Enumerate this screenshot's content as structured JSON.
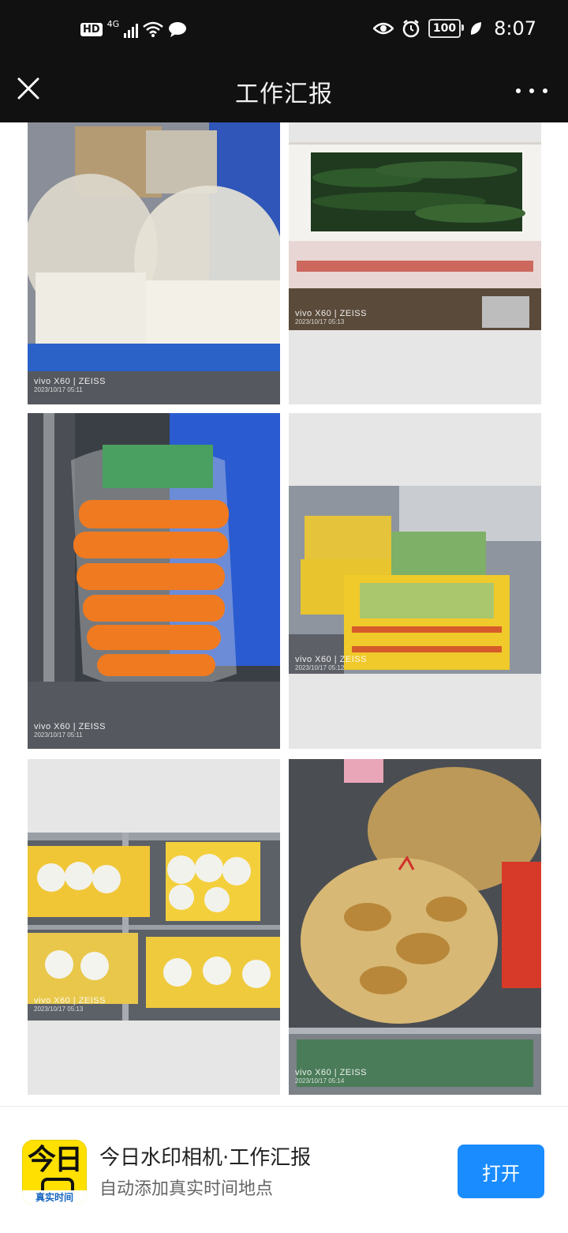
{
  "status_bar": {
    "hd": "HD",
    "network": "4G",
    "battery": "100",
    "time": "8:07",
    "icons": [
      "signal-icon",
      "wifi-icon",
      "message-icon",
      "eye-icon",
      "alarm-icon",
      "battery-icon",
      "leaf-icon"
    ]
  },
  "header": {
    "title": "工作汇报",
    "close_icon": "close-icon",
    "more_icon": "more-icon"
  },
  "photos": [
    {
      "subject": "tofu in plastic bags, blue crate",
      "watermark_brand": "vivo X60 | ZEISS",
      "watermark_date": "2023/10/17 05:11"
    },
    {
      "subject": "cucumbers in foam box",
      "watermark_brand": "vivo X60 | ZEISS",
      "watermark_date": "2023/10/17 05:13"
    },
    {
      "subject": "bag of carrots",
      "watermark_brand": "vivo X60 | ZEISS",
      "watermark_date": "2023/10/17 05:11"
    },
    {
      "subject": "packed green vegetables",
      "watermark_brand": "vivo X60 | ZEISS",
      "watermark_date": "2023/10/17 05:12"
    },
    {
      "subject": "packed cabbages on shelves",
      "watermark_brand": "vivo X60 | ZEISS",
      "watermark_date": "2023/10/17 05:13"
    },
    {
      "subject": "bag of ginger",
      "watermark_brand": "vivo X60 | ZEISS",
      "watermark_date": "2023/10/17 05:14"
    }
  ],
  "promo": {
    "icon_text": "今日",
    "icon_strip": "真实时间",
    "title": "今日水印相机·工作汇报",
    "subtitle": "自动添加真实时间地点",
    "open_label": "打开"
  },
  "colors": {
    "bar_bg": "#111111",
    "accent": "#1a8cff",
    "icon_yellow": "#ffe000"
  }
}
